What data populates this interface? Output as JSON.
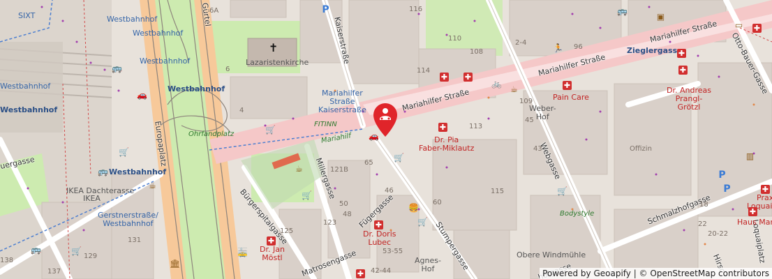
{
  "map": {
    "marker": {
      "name": "location-marker",
      "color": "#e0242a"
    },
    "streets": {
      "mariahilfer_1": "Mariahilfer Straße",
      "mariahilfer_2": "Mariahilfer Straße",
      "mariahilfer_3": "Mariahilfer Straße",
      "zieglergasse": "Zieglergasse",
      "kaiserstrasse": "Kaiserstraße",
      "webgasse": "Webgasse",
      "stumpergasse": "Stumpergasse",
      "millergasse": "Millergasse",
      "fuegergasse": "Fügergasse",
      "buergerspitalgasse": "Bürgerspitalgasse",
      "matrosengasse": "Matrosengasse",
      "europaplatz": "Europaplatz",
      "guertel": "Gürtel",
      "schmalzhofgasse": "Schmalzhofgasse",
      "otto_bauer": "Otto-Bauer-Gasse",
      "loquaiplatz": "Loquaiplatz",
      "uergasse": "uergasse",
      "weber": "Webgasse",
      "hirsc": "Hirsc",
      "hofgasse": "hofgasse"
    },
    "places": {
      "westbahnhof_1": "Westbahnhof",
      "westbahnhof_2": "Westbahnhof",
      "westbahnhof_3": "Westbahnhof",
      "westbahnhof_4": "Westbahnhof",
      "westbahnhof_5": "Westbahnhof",
      "westbahnhof_big": "Westbahnhof",
      "westbahnhof_bold": "Westbahnhof",
      "lazaristenkirche": "Lazaristenkirche",
      "mariahilfer_stop": "Mariahilfer\nStraße\nKaiserstraße",
      "fitinn": "FITINN",
      "mariahilf_green": "Mariahilf",
      "ikea": "IKEA Dachterasse",
      "ikea2": "IKEA",
      "gerstner": "Gerstnerstraße/\nWestbahnhof",
      "pain_care": "Pain Care",
      "andreas": "Dr. Andreas\nPrangl-\nGrötzl",
      "pia": "Dr. Pia\nFaber-Miklautz",
      "doris": "Dr. Doris\nLubec",
      "jan": "Dr. Jan\nMöstl",
      "weberhof": "Weber-\nHof",
      "offizin": "Offizin",
      "bodystyle": "Bodystyle",
      "obere_windmuehle": "Obere Windmühle",
      "agnes_hof": "Agnes-\nHof",
      "haus_mariahilf": "Haus Mariahilf",
      "praxi": "Praxi",
      "loquai": "Loquai",
      "sixt": "SIXT",
      "ohrfandplatz": "Ohrfandplatz"
    },
    "numbers": [
      "116",
      "110",
      "108",
      "114",
      "109",
      "113",
      "115",
      "45",
      "43",
      "6",
      "4",
      "2-4",
      "96",
      "121B",
      "65",
      "50",
      "48",
      "123",
      "125",
      "131",
      "137",
      "138",
      "22",
      "60",
      "53-55",
      "42-44",
      "46",
      "6A",
      "18",
      "20-22",
      "129"
    ],
    "attribution": "Powered by Geoapify | © OpenStreetMap contributors",
    "colors": {
      "background": "#e8e2db",
      "building": "#d9d0c9",
      "pedestrian": "#f5c8c8",
      "park": "#cdebb0",
      "rail": "#b7b0a8",
      "highway": "#f7c99a",
      "road": "#ffffff"
    }
  }
}
